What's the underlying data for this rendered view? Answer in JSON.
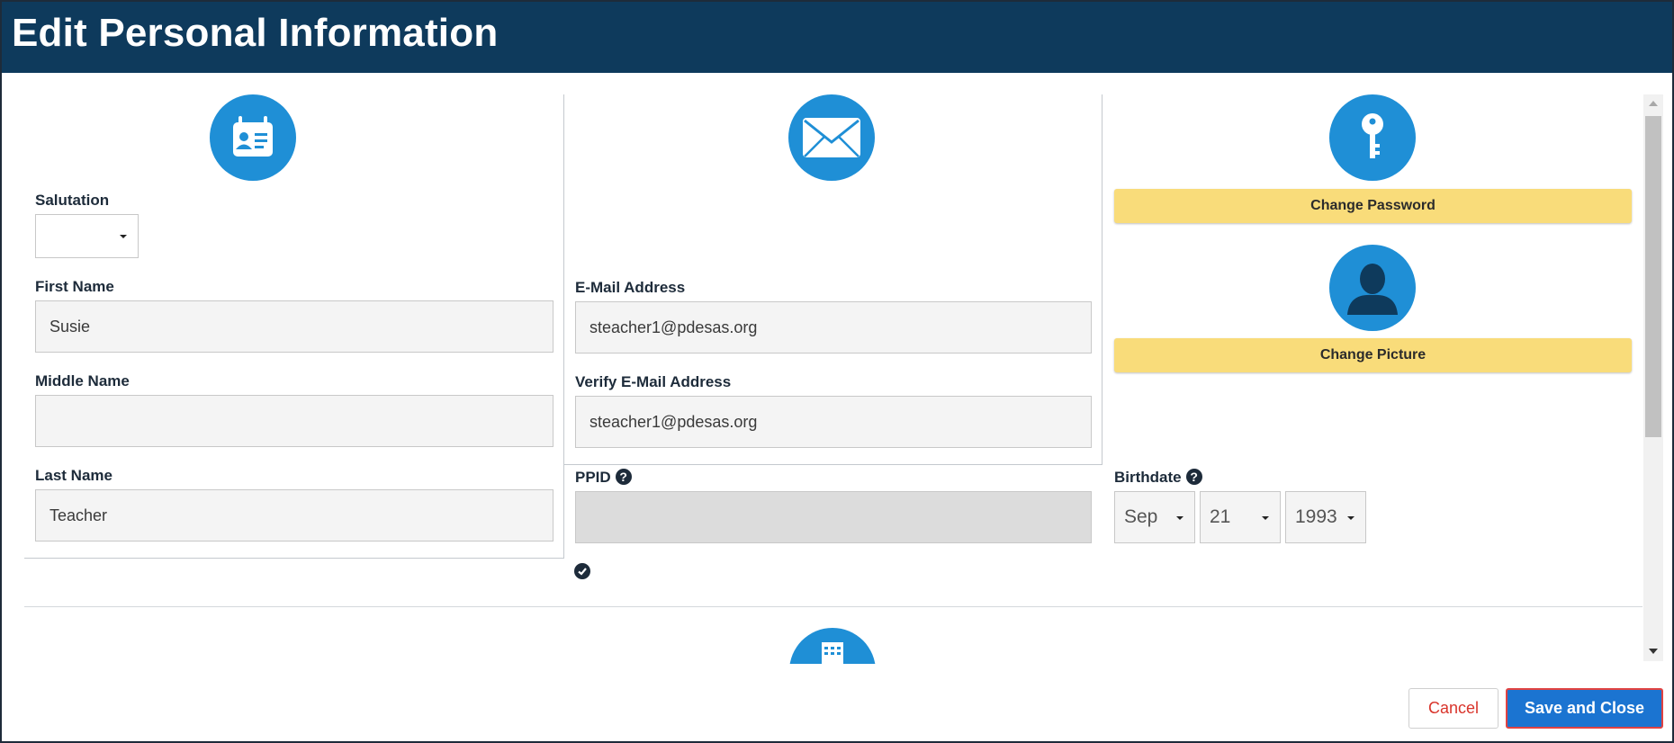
{
  "header": {
    "title": "Edit Personal Information"
  },
  "personal": {
    "salutation_label": "Salutation",
    "salutation_value": "",
    "first_name_label": "First Name",
    "first_name_value": "Susie",
    "middle_name_label": "Middle Name",
    "middle_name_value": "",
    "last_name_label": "Last Name",
    "last_name_value": "Teacher"
  },
  "email": {
    "email_label": "E-Mail Address",
    "email_value": "steacher1@pdesas.org",
    "verify_label": "Verify E-Mail Address",
    "verify_value": "steacher1@pdesas.org"
  },
  "ppid": {
    "label": "PPID",
    "value": ""
  },
  "account": {
    "change_password_label": "Change Password",
    "change_picture_label": "Change Picture"
  },
  "birthdate": {
    "label": "Birthdate",
    "month": "Sep",
    "day": "21",
    "year": "1993"
  },
  "footer": {
    "cancel_label": "Cancel",
    "save_label": "Save and Close"
  },
  "colors": {
    "header_bg": "#0e3a5c",
    "icon_circle": "#1f8fd6",
    "yellow_button": "#f9dc7a",
    "primary_button": "#1b74d1",
    "cancel_text": "#d9342b"
  },
  "icons": {
    "personal": "id-badge-icon",
    "email": "envelope-icon",
    "password": "key-icon",
    "picture": "user-silhouette-icon",
    "help": "question-circle-icon",
    "check": "check-circle-icon",
    "calendar": "calendar-icon"
  }
}
